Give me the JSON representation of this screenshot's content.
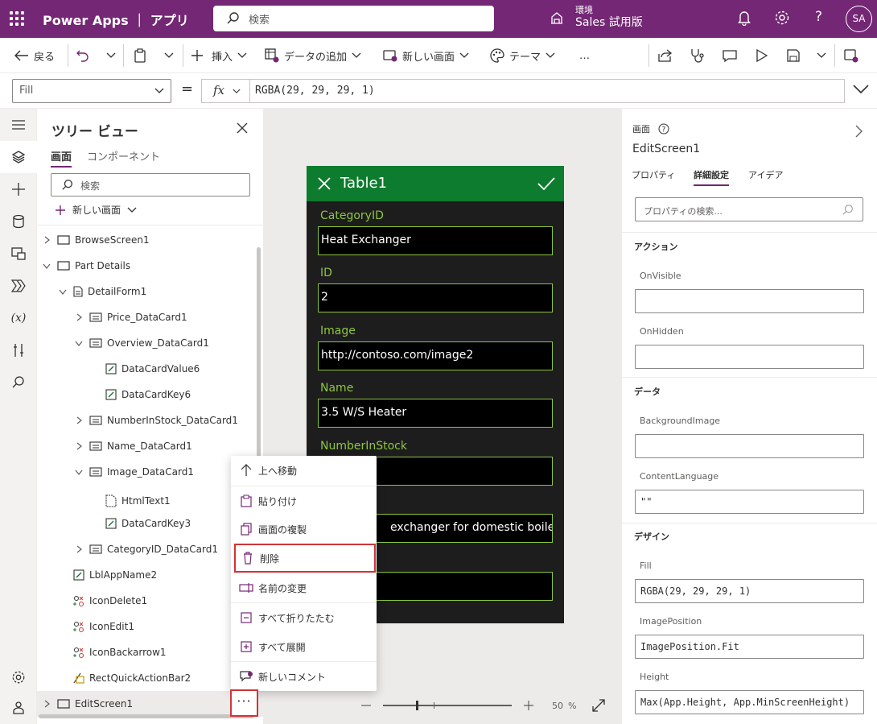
{
  "topbar": {
    "app_name": "Power Apps ｜ アプリ",
    "search_placeholder": "検索",
    "env_label": "環境",
    "env_name": "Sales 試用版",
    "user_initials": "SA"
  },
  "commandbar": {
    "back": "戻る",
    "insert": "挿入",
    "add_data": "データの追加",
    "new_screen": "新しい画面",
    "theme": "テーマ",
    "more": "…"
  },
  "formula": {
    "property": "Fill",
    "equals": "=",
    "fx": "fx",
    "value": "RGBA(29, 29, 29, 1)"
  },
  "tree": {
    "title": "ツリー ビュー",
    "tabs": [
      "画面",
      "コンポーネント"
    ],
    "search_placeholder": "検索",
    "new_screen": "新しい画面",
    "nodes": [
      {
        "label": "BrowseScreen1"
      },
      {
        "label": "Part Details"
      },
      {
        "label": "DetailForm1"
      },
      {
        "label": "Price_DataCard1"
      },
      {
        "label": "Overview_DataCard1"
      },
      {
        "label": "DataCardValue6"
      },
      {
        "label": "DataCardKey6"
      },
      {
        "label": "NumberInStock_DataCard1"
      },
      {
        "label": "Name_DataCard1"
      },
      {
        "label": "Image_DataCard1"
      },
      {
        "label": "HtmlText1"
      },
      {
        "label": "DataCardKey3"
      },
      {
        "label": "CategoryID_DataCard1"
      },
      {
        "label": "LblAppName2"
      },
      {
        "label": "IconDelete1"
      },
      {
        "label": "IconEdit1"
      },
      {
        "label": "IconBackarrow1"
      },
      {
        "label": "RectQuickActionBar2"
      },
      {
        "label": "EditScreen1"
      }
    ],
    "more_button": "···"
  },
  "context_menu": {
    "items": [
      "上へ移動",
      "貼り付け",
      "画面の複製",
      "削除",
      "名前の変更",
      "すべて折りたたむ",
      "すべて展開",
      "新しいコメント"
    ]
  },
  "app_preview": {
    "title": "Table1",
    "fields": [
      {
        "label": "CategoryID",
        "value": "Heat Exchanger"
      },
      {
        "label": "ID",
        "value": "2"
      },
      {
        "label": "Image",
        "value": "http://contoso.com/image2"
      },
      {
        "label": "Name",
        "value": "3.5 W/S Heater"
      },
      {
        "label": "NumberInStock",
        "value": ""
      },
      {
        "label": "",
        "value": "exchanger for domestic boiler"
      },
      {
        "label": "",
        "value": ""
      }
    ],
    "zoom": "50",
    "zoom_unit": "%",
    "zoom_level": 0.5
  },
  "properties": {
    "kind": "画面",
    "name": "EditScreen1",
    "tabs": [
      "プロパティ",
      "詳細設定",
      "アイデア"
    ],
    "search_placeholder": "プロパティの検索...",
    "sections": {
      "actions": "アクション",
      "data": "データ",
      "design": "デザイン"
    },
    "fields": {
      "onvisible_label": "OnVisible",
      "onvisible_value": "",
      "onhidden_label": "OnHidden",
      "onhidden_value": "",
      "bgimage_label": "BackgroundImage",
      "bgimage_value": "",
      "contentlang_label": "ContentLanguage",
      "contentlang_value": "\"\"",
      "fill_label": "Fill",
      "fill_value": "RGBA(29, 29, 29, 1)",
      "imagepos_label": "ImagePosition",
      "imagepos_value": "ImagePosition.Fit",
      "height_label": "Height",
      "height_value": "Max(App.Height, App.MinScreenHeight)"
    }
  },
  "colors": {
    "brand": "#742774",
    "app_header": "#0e7c2e",
    "app_bg": "#1d1d1d",
    "field_accent": "#8cc63f",
    "highlight": "#d13438"
  }
}
